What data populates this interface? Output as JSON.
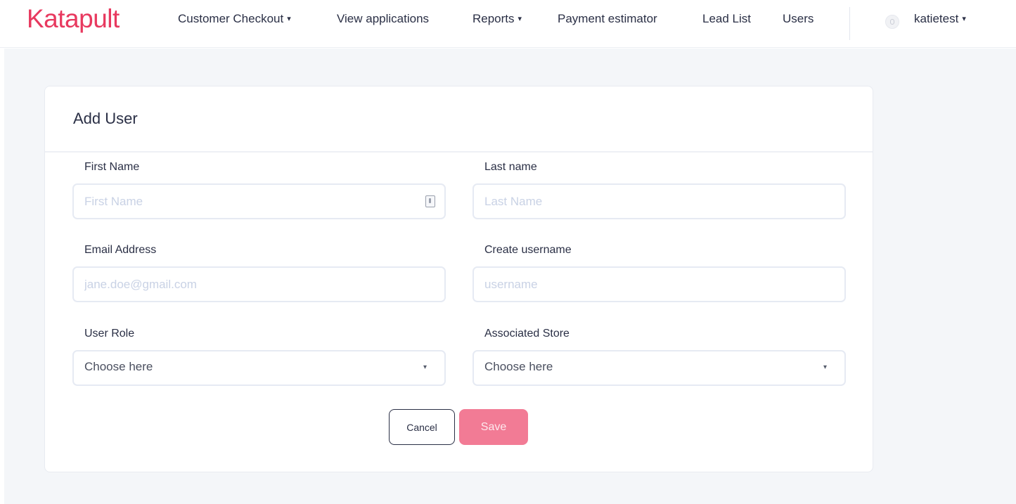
{
  "brand": {
    "name": "Katapult",
    "color": "#e8395f"
  },
  "nav": {
    "customer_checkout": "Customer Checkout",
    "view_applications": "View applications",
    "reports": "Reports",
    "payment_estimator": "Payment estimator",
    "lead_list": "Lead List",
    "users": "Users",
    "user_menu": "katietest",
    "caret": "▾"
  },
  "form": {
    "title": "Add User",
    "first_name": {
      "label": "First Name",
      "placeholder": "First Name"
    },
    "last_name": {
      "label": "Last name",
      "placeholder": "Last Name"
    },
    "email": {
      "label": "Email Address",
      "placeholder": "jane.doe@gmail.com"
    },
    "username": {
      "label": "Create username",
      "placeholder": "username"
    },
    "user_role": {
      "label": "User Role",
      "value": "Choose here"
    },
    "store": {
      "label": "Associated Store",
      "value": "Choose here"
    },
    "cancel_label": "Cancel",
    "save_label": "Save",
    "select_caret": "▾"
  },
  "colors": {
    "save_button": "#f27b95",
    "page_bg": "#f4f6f9",
    "input_border": "#e6eaf3"
  }
}
